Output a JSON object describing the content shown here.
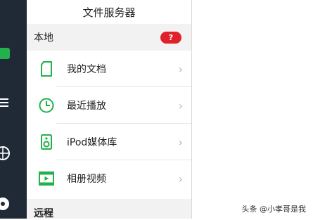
{
  "header": {
    "title": "文件服务器"
  },
  "local_section": {
    "label": "本地",
    "badge": "?"
  },
  "items": [
    {
      "label": "我的文档",
      "icon": "document-icon"
    },
    {
      "label": "最近播放",
      "icon": "clock-icon"
    },
    {
      "label": "iPod媒体库",
      "icon": "speaker-icon"
    },
    {
      "label": "相册视频",
      "icon": "film-icon"
    }
  ],
  "remote_section": {
    "label": "远程"
  },
  "watermark": "头条 @小孝哥是我",
  "colors": {
    "accent": "#22b14c",
    "badge": "#e0202a",
    "rail": "#1f2a36"
  }
}
